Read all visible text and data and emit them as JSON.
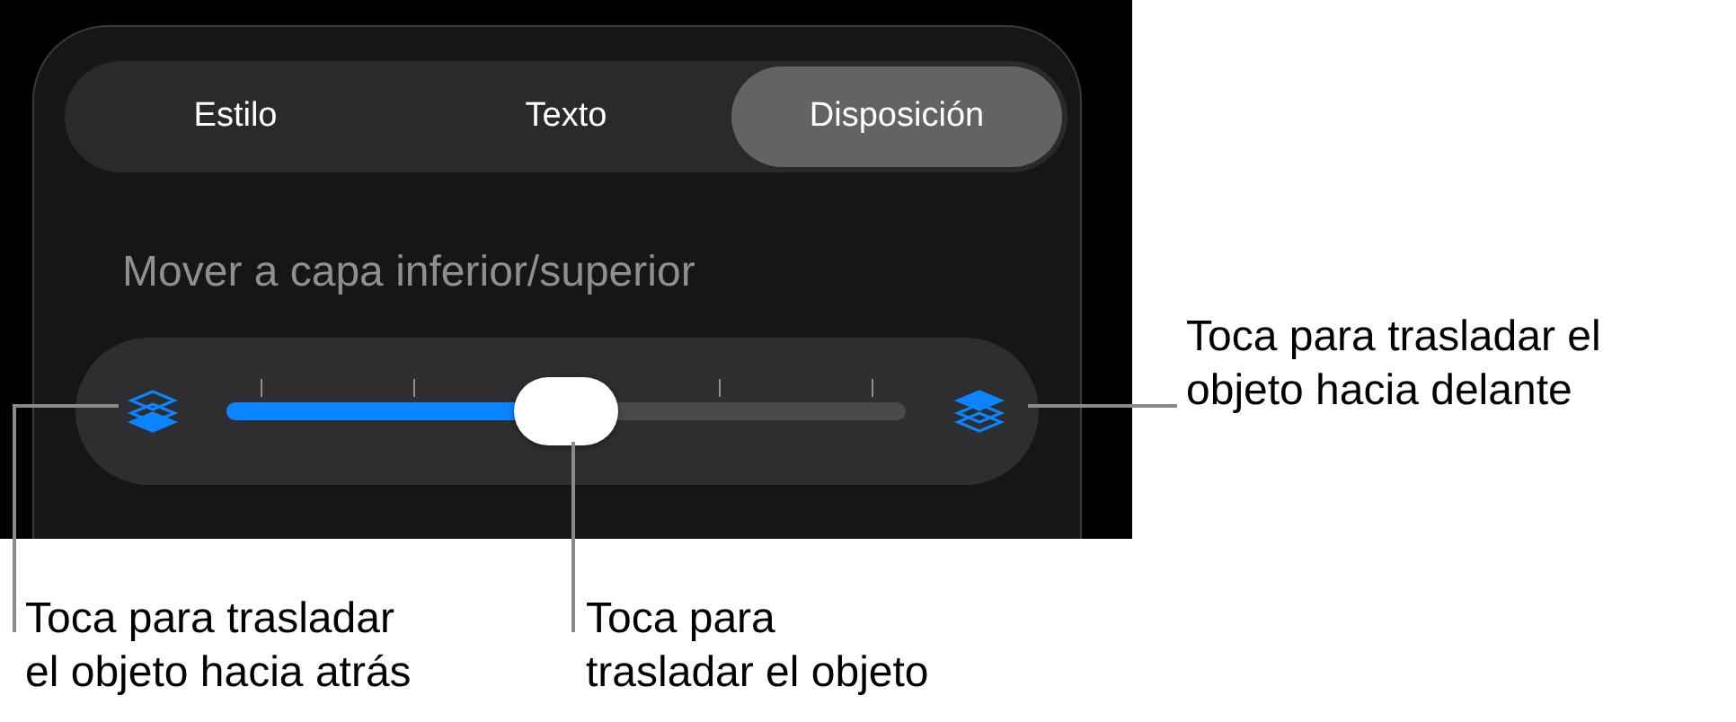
{
  "tabs": [
    {
      "label": "Estilo",
      "selected": false
    },
    {
      "label": "Texto",
      "selected": false
    },
    {
      "label": "Disposición",
      "selected": true
    }
  ],
  "section_title": "Mover a capa inferior/superior",
  "slider": {
    "level": 0.5
  },
  "callouts": [
    {
      "lines": [
        "Toca para trasladar",
        "el objeto hacia atrás"
      ]
    },
    {
      "lines": [
        "Toca para",
        "trasladar el objeto"
      ]
    },
    {
      "lines": [
        "Toca para trasladar el",
        "objeto hacia delante"
      ]
    }
  ]
}
